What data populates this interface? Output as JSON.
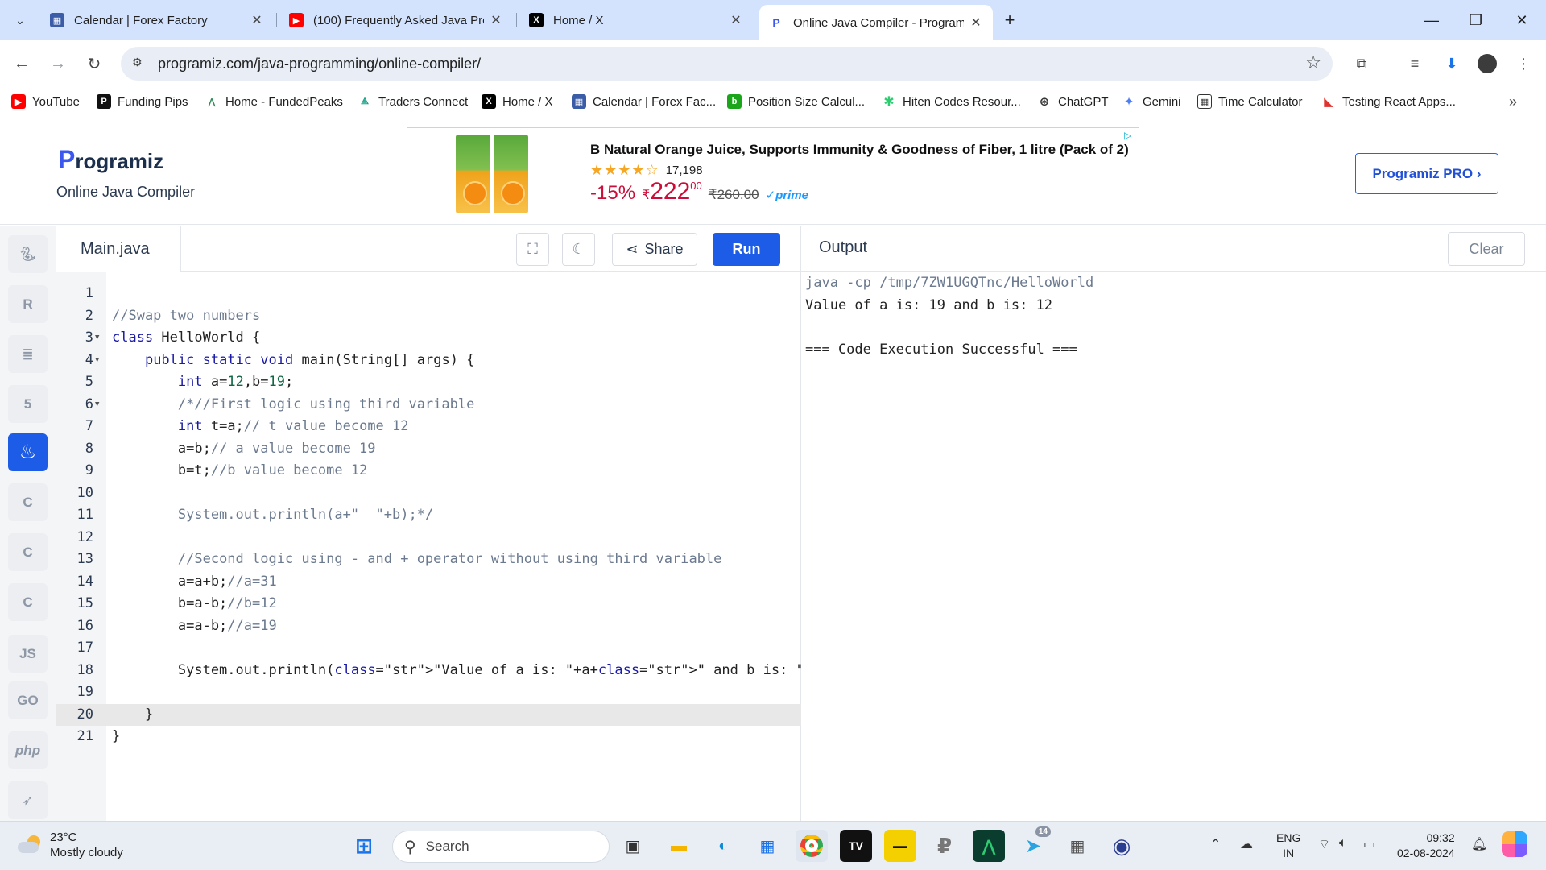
{
  "browser": {
    "tabs": [
      {
        "title": "Calendar | Forex Factory",
        "icon": "forex-factory-icon",
        "active": false
      },
      {
        "title": "(100) Frequently Asked Java Pro",
        "icon": "youtube-icon",
        "active": false
      },
      {
        "title": "Home / X",
        "icon": "x-icon",
        "active": false
      },
      {
        "title": "Online Java Compiler - Program",
        "icon": "programiz-icon",
        "active": true
      }
    ],
    "url": "programiz.com/java-programming/online-compiler/",
    "bookmarks": [
      {
        "label": "YouTube",
        "icon": "youtube-icon"
      },
      {
        "label": "Funding Pips",
        "icon": "funding-pips-icon"
      },
      {
        "label": "Home - FundedPeaks",
        "icon": "fundedpeaks-icon"
      },
      {
        "label": "Traders Connect",
        "icon": "traders-connect-icon"
      },
      {
        "label": "Home / X",
        "icon": "x-icon"
      },
      {
        "label": "Calendar | Forex Fac...",
        "icon": "forex-factory-icon"
      },
      {
        "label": "Position Size Calcul...",
        "icon": "position-size-icon"
      },
      {
        "label": "Hiten Codes Resour...",
        "icon": "hiten-codes-icon"
      },
      {
        "label": "ChatGPT",
        "icon": "chatgpt-icon"
      },
      {
        "label": "Gemini",
        "icon": "gemini-icon"
      },
      {
        "label": "Time Calculator",
        "icon": "calculator-icon"
      },
      {
        "label": "Testing React Apps...",
        "icon": "testing-icon"
      }
    ]
  },
  "site": {
    "logo_text": "rogramiz",
    "logo_letter": "P",
    "subtitle": "Online Java Compiler",
    "pro_button": "Programiz PRO ›",
    "ad": {
      "title": "B Natural Orange Juice, Supports Immunity & Goodness of Fiber, 1 litre (Pack of 2)",
      "stars": "★★★★☆",
      "rating_count": "17,198",
      "discount": "-15%",
      "currency": "₹",
      "price": "222",
      "price_cents": "00",
      "old_price": "₹260.00",
      "prime": "✓prime"
    }
  },
  "compiler": {
    "languages": [
      "python-icon",
      "r-icon",
      "sql-icon",
      "html-icon",
      "java-icon",
      "c-icon",
      "cpp-icon",
      "csharp-icon",
      "js-icon",
      "go-icon",
      "php-icon",
      "swift-icon"
    ],
    "language_labels": {
      "js": "JS",
      "go": "GO",
      "php": "php"
    },
    "active_language": "java-icon",
    "file_name": "Main.java",
    "share_label": "Share",
    "run_label": "Run",
    "output_label": "Output",
    "clear_label": "Clear",
    "code_lines": [
      "",
      "//Swap two numbers",
      "class HelloWorld {",
      "    public static void main(String[] args) {",
      "        int a=12,b=19;",
      "        /*//First logic using third variable",
      "        int t=a;// t value become 12",
      "        a=b;// a value become 19",
      "        b=t;//b value become 12",
      "",
      "        System.out.println(a+\"  \"+b);*/",
      "",
      "        //Second logic using - and + operator without using third variable",
      "        a=a+b;//a=31",
      "        b=a-b;//b=12",
      "        a=a-b;//a=19",
      "",
      "        System.out.println(\"Value of a is: \"+a+\" and b is: \"+b);",
      "",
      "    }",
      "}"
    ],
    "highlighted_line": 20,
    "output_lines": [
      "java -cp /tmp/7ZW1UGQTnc/HelloWorld",
      "Value of a is: 19 and b is: 12",
      "",
      "=== Code Execution Successful ==="
    ]
  },
  "taskbar": {
    "temperature": "23°C",
    "weather": "Mostly cloudy",
    "search_placeholder": "Search",
    "language": "ENG",
    "region": "IN",
    "time": "09:32",
    "date": "02-08-2024",
    "telegram_badge": "14"
  },
  "colors": {
    "accent": "#1d5ce6",
    "tabstrip": "#d3e3fd",
    "sale_red": "#cc0c39"
  }
}
